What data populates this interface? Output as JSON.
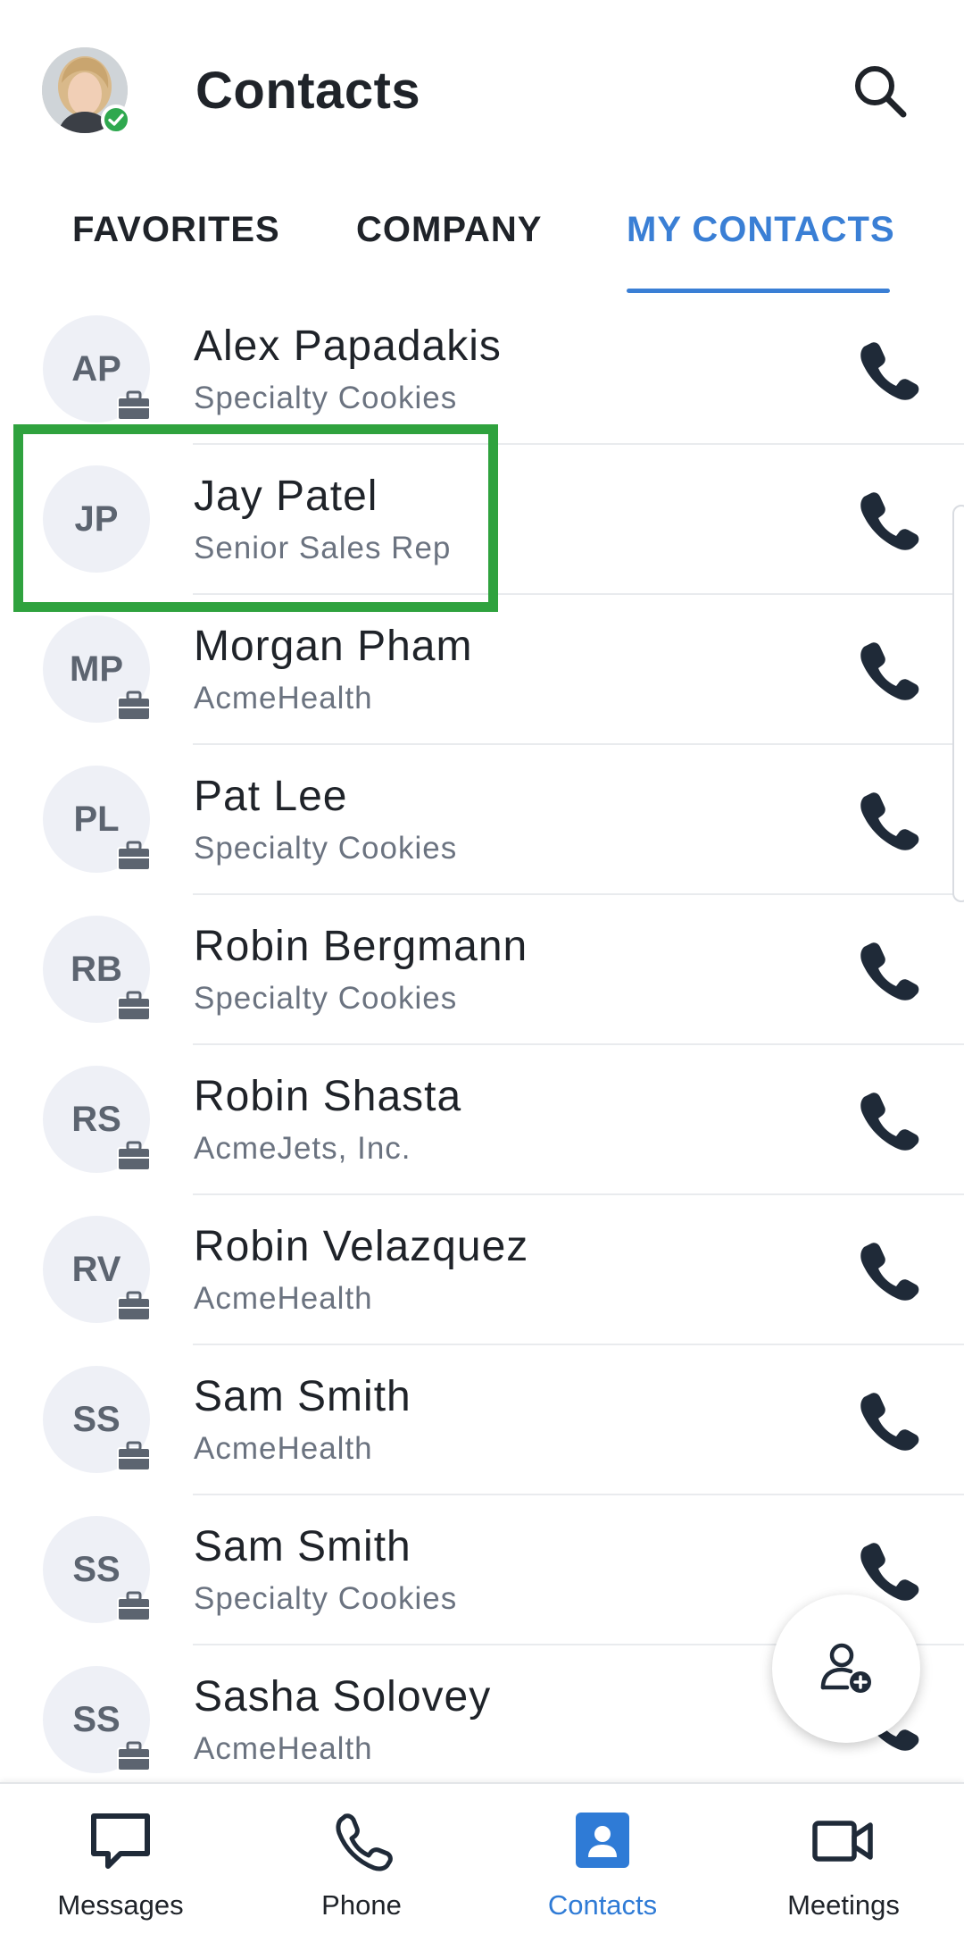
{
  "header": {
    "title": "Contacts"
  },
  "tabs": [
    {
      "label": "FAVORITES"
    },
    {
      "label": "COMPANY"
    },
    {
      "label": "MY CONTACTS"
    }
  ],
  "contacts": [
    {
      "initials": "AP",
      "name": "Alex Papadakis",
      "subtitle": "Specialty Cookies",
      "business": true
    },
    {
      "initials": "JP",
      "name": "Jay Patel",
      "subtitle": "Senior Sales Rep",
      "business": false
    },
    {
      "initials": "MP",
      "name": "Morgan Pham",
      "subtitle": "AcmeHealth",
      "business": true
    },
    {
      "initials": "PL",
      "name": "Pat Lee",
      "subtitle": "Specialty Cookies",
      "business": true
    },
    {
      "initials": "RB",
      "name": "Robin Bergmann",
      "subtitle": "Specialty Cookies",
      "business": true
    },
    {
      "initials": "RS",
      "name": "Robin Shasta",
      "subtitle": "AcmeJets, Inc.",
      "business": true
    },
    {
      "initials": "RV",
      "name": "Robin Velazquez",
      "subtitle": "AcmeHealth",
      "business": true
    },
    {
      "initials": "SS",
      "name": "Sam Smith",
      "subtitle": "AcmeHealth",
      "business": true
    },
    {
      "initials": "SS",
      "name": "Sam Smith",
      "subtitle": "Specialty Cookies",
      "business": true
    },
    {
      "initials": "SS",
      "name": "Sasha Solovey",
      "subtitle": "AcmeHealth",
      "business": true
    }
  ],
  "bottom_nav": [
    {
      "label": "Messages",
      "icon": "message-icon"
    },
    {
      "label": "Phone",
      "icon": "phone-icon"
    },
    {
      "label": "Contacts",
      "icon": "contacts-icon"
    },
    {
      "label": "Meetings",
      "icon": "video-camera-icon"
    }
  ],
  "colors": {
    "accent": "#3a7fd5",
    "text": "#1f2329",
    "subtext": "#6b7380",
    "avatar_bg": "#eef0f6",
    "highlight": "#2fa23e",
    "presence": "#2fa84f"
  }
}
